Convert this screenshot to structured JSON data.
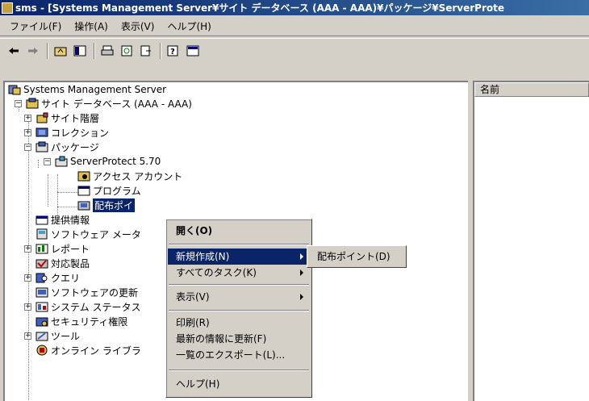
{
  "window": {
    "title": "sms - [Systems Management Server¥サイト データベース (AAA - AAA)¥パッケージ¥ServerProte"
  },
  "menubar": {
    "items": [
      {
        "label": "ファイル(F)"
      },
      {
        "label": "操作(A)"
      },
      {
        "label": "表示(V)"
      },
      {
        "label": "ヘルプ(H)"
      }
    ]
  },
  "toolbar": {
    "buttons": [
      {
        "icon": "back-arrow-icon"
      },
      {
        "icon": "forward-arrow-icon"
      },
      {
        "icon": "up-folder-icon"
      },
      {
        "icon": "show-tree-icon"
      },
      {
        "icon": "print-icon"
      },
      {
        "icon": "refresh-icon"
      },
      {
        "icon": "export-list-icon"
      },
      {
        "icon": "help-icon"
      },
      {
        "icon": "properties-icon"
      }
    ]
  },
  "tree": {
    "nodes": [
      {
        "label": "Systems Management Server",
        "icon": "sms-root-icon"
      },
      {
        "label": "サイト データベース (AAA - AAA)",
        "icon": "site-database-icon"
      },
      {
        "label": "サイト階層",
        "icon": "site-hierarchy-icon"
      },
      {
        "label": "コレクション",
        "icon": "collection-icon"
      },
      {
        "label": "パッケージ",
        "icon": "package-icon"
      },
      {
        "label": "ServerProtect 5.70",
        "icon": "package-item-icon"
      },
      {
        "label": "アクセス アカウント",
        "icon": "access-account-icon"
      },
      {
        "label": "プログラム",
        "icon": "program-icon"
      },
      {
        "label": "配布ポイ",
        "icon": "distribution-point-icon"
      },
      {
        "label": "提供情報",
        "icon": "advertisement-icon"
      },
      {
        "label": "ソフトウェア メータ",
        "icon": "software-metering-icon"
      },
      {
        "label": "レポート",
        "icon": "report-icon"
      },
      {
        "label": "対応製品",
        "icon": "product-compliance-icon"
      },
      {
        "label": "クエリ",
        "icon": "query-icon"
      },
      {
        "label": "ソフトウェアの更新",
        "icon": "software-update-icon"
      },
      {
        "label": "システム ステータス",
        "icon": "system-status-icon"
      },
      {
        "label": "セキュリティ権限",
        "icon": "security-rights-icon"
      },
      {
        "label": "ツール",
        "icon": "tools-icon"
      },
      {
        "label": "オンライン ライブラ",
        "icon": "online-library-icon"
      }
    ]
  },
  "right_pane": {
    "column_header": "名前"
  },
  "context_menu": {
    "items": [
      {
        "label": "開く(O)"
      },
      {
        "label": "新規作成(N)"
      },
      {
        "label": "すべてのタスク(K)"
      },
      {
        "label": "表示(V)"
      },
      {
        "label": "印刷(R)"
      },
      {
        "label": "最新の情報に更新(F)"
      },
      {
        "label": "一覧のエクスポート(L)..."
      },
      {
        "label": "ヘルプ(H)"
      }
    ],
    "submenu": {
      "items": [
        {
          "label": "配布ポイント(D)"
        }
      ]
    }
  },
  "colors": {
    "title_start": "#0a246a",
    "title_end": "#3a6ea5",
    "selection": "#0a246a",
    "face": "#d4d0c8"
  }
}
